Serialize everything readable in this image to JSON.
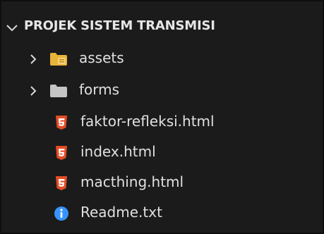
{
  "explorer": {
    "title": "PROJEK SISTEM TRANSMISI",
    "items": [
      {
        "label": "assets",
        "kind": "folder",
        "icon": "folder-assets-icon"
      },
      {
        "label": "forms",
        "kind": "folder",
        "icon": "folder-icon"
      },
      {
        "label": "faktor-refleksi.html",
        "kind": "file",
        "icon": "html5-icon"
      },
      {
        "label": "index.html",
        "kind": "file",
        "icon": "html5-icon"
      },
      {
        "label": "macthing.html",
        "kind": "file",
        "icon": "html5-icon"
      },
      {
        "label": "Readme.txt",
        "kind": "file",
        "icon": "info-icon"
      }
    ]
  },
  "colors": {
    "background": "#1b1b1b",
    "html_icon": "#e44d26",
    "info_icon": "#3794ff",
    "assets_folder": "#e8b339",
    "folder": "#c5c5c5"
  }
}
